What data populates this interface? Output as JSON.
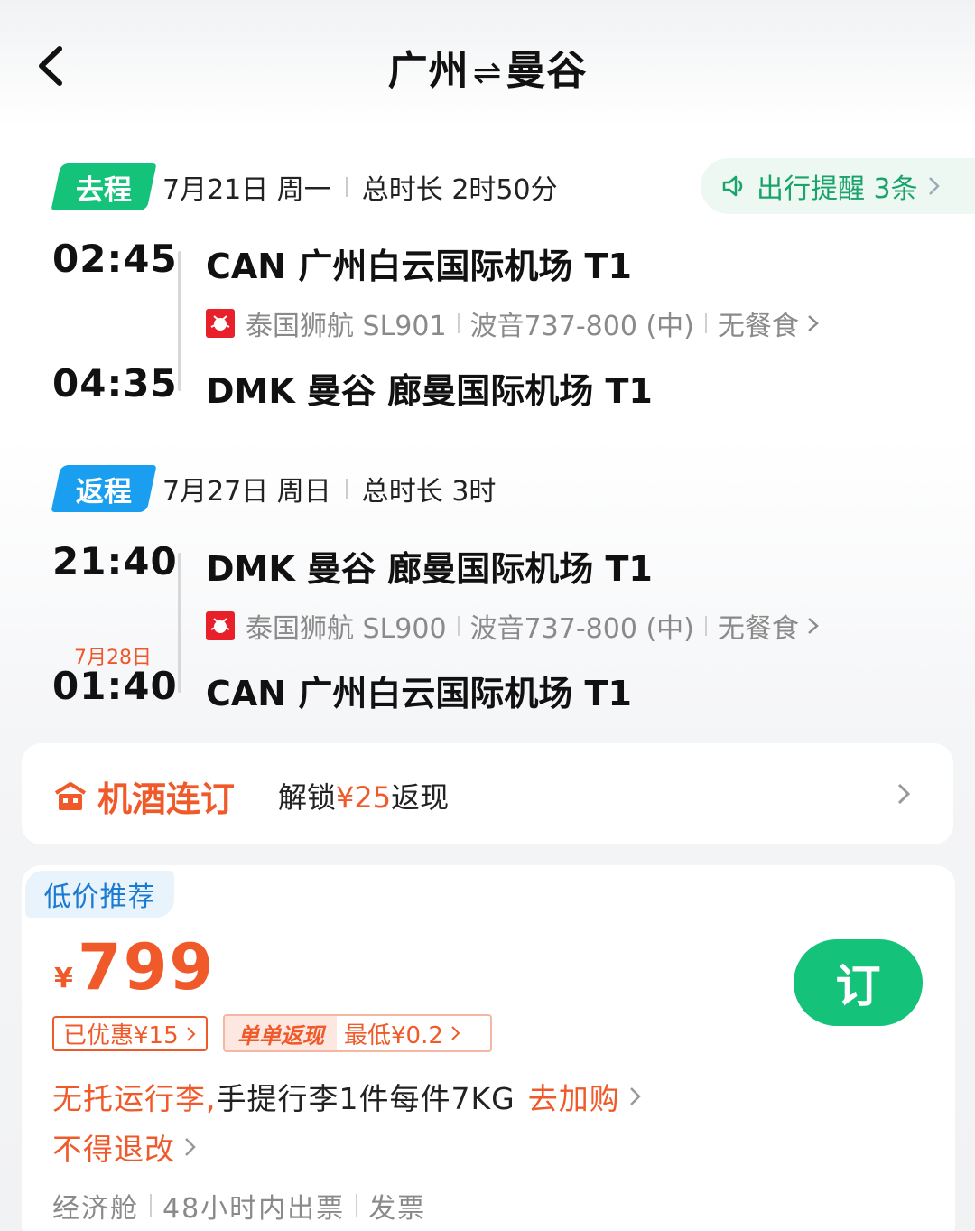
{
  "header": {
    "origin": "广州",
    "arrow": "⇌",
    "destination": "曼谷"
  },
  "outbound": {
    "tag": "去程",
    "date": "7月21日 周一",
    "duration": "总时长 2时50分",
    "reminder": "出行提醒 3条",
    "depart_time": "02:45",
    "depart_airport": "CAN 广州白云国际机场 T1",
    "airline": "泰国狮航 SL901",
    "aircraft": "波音737-800 (中)",
    "meal": "无餐食",
    "arrive_time": "04:35",
    "arrive_airport": "DMK 曼谷 廊曼国际机场 T1"
  },
  "return": {
    "tag": "返程",
    "date": "7月27日 周日",
    "duration": "总时长 3时",
    "depart_time": "21:40",
    "depart_airport": "DMK 曼谷 廊曼国际机场 T1",
    "airline": "泰国狮航 SL900",
    "aircraft": "波音737-800 (中)",
    "meal": "无餐食",
    "arrive_date": "7月28日",
    "arrive_time": "01:40",
    "arrive_airport": "CAN 广州白云国际机场 T1"
  },
  "package": {
    "title": "机酒连订",
    "desc_prefix": "解锁",
    "desc_amount": "¥25",
    "desc_suffix": "返现"
  },
  "offer": {
    "tag": "低价推荐",
    "currency": "¥",
    "price": "799",
    "book_label": "订",
    "discount": "已优惠¥15",
    "cashback_label": "单单返现",
    "cashback_value": "最低¥0.2",
    "baggage_warn": "无托运行李,",
    "baggage_info": "手提行李1件每件7KG",
    "baggage_add": "去加购",
    "refund": "不得退改",
    "cabin": "经济舱",
    "ticketing": "48小时内出票",
    "invoice": "发票"
  },
  "colors": {
    "green": "#14c27a",
    "blue": "#1a9ff0",
    "orange": "#f05a2a",
    "reminder_text": "#1aa36a"
  }
}
